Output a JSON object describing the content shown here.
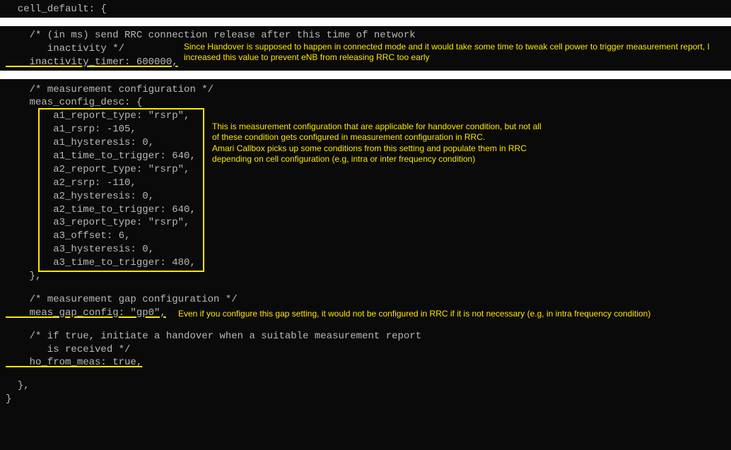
{
  "top": {
    "line1": "  cell_default: {"
  },
  "section2": {
    "comment1": "    /* (in ms) send RRC connection release after this time of network",
    "comment2": "       inactivity */",
    "setting": "    inactivity_timer: 600000,",
    "annotation": "Since Handover is supposed to happen in connected mode and it would take some time to tweak cell power to trigger measurement report, I increased this value to prevent eNB from releasing RRC too early"
  },
  "section3": {
    "comment": "    /* measurement configuration */",
    "open": "    meas_config_desc: {",
    "lines": [
      "        a1_report_type: \"rsrp\",",
      "        a1_rsrp: -105,",
      "        a1_hysteresis: 0,",
      "        a1_time_to_trigger: 640,",
      "        a2_report_type: \"rsrp\",",
      "        a2_rsrp: -110,",
      "        a2_hysteresis: 0,",
      "        a2_time_to_trigger: 640,",
      "        a3_report_type: \"rsrp\",",
      "        a3_offset: 6,",
      "        a3_hysteresis: 0,",
      "        a3_time_to_trigger: 480,"
    ],
    "close": "    },",
    "annotation": "This is measurement configuration that are applicable for handover condition, but not all\nof these condition gets configured in measurement configuration in RRC.\nAmari Callbox picks up some conditions from this setting and populate them in RRC\ndepending on cell configuration (e.g, intra or inter frequency condition)",
    "gap_comment": "    /* measurement gap configuration */",
    "gap_setting": "    meas_gap_config: \"gp0\",",
    "gap_annotation": "Even if you configure this gap setting, it would not be configured in RRC if it is not necessary (e.g, in intra frequency condition)",
    "ho_comment1": "    /* if true, initiate a handover when a suitable measurement report",
    "ho_comment2": "       is received */",
    "ho_setting": "    ho_from_meas: true,",
    "close1": "  },",
    "close2": "}"
  }
}
